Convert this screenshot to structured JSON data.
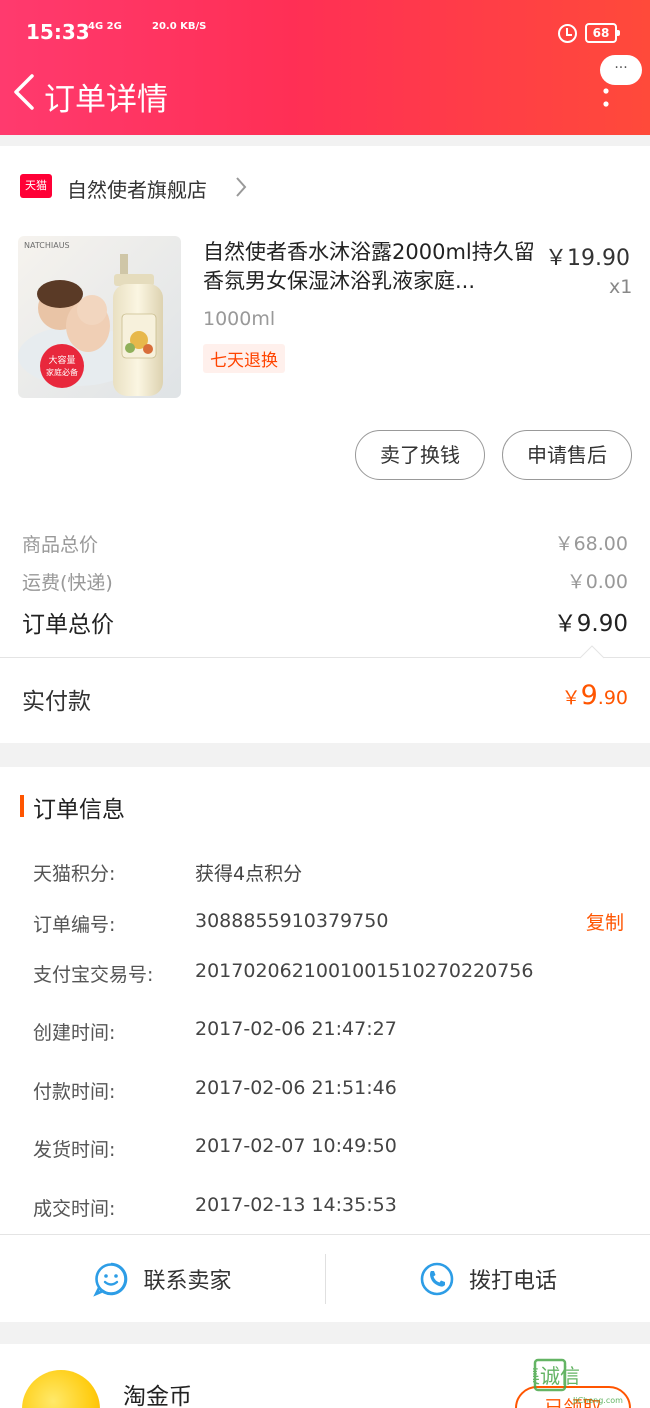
{
  "status_bar": {
    "time": "15:33",
    "signal_text": "4G 2G",
    "speed": "20.0 KB/S",
    "battery": "68"
  },
  "header": {
    "title": "订单详情",
    "more_label": "···"
  },
  "shop": {
    "badge": "天猫",
    "name": "自然使者旗舰店"
  },
  "product": {
    "title": "自然使者香水沐浴露2000ml持久留香氛男女保湿沐浴乳液家庭...",
    "price": "￥19.90",
    "quantity": "x1",
    "spec": "1000ml",
    "return_tag": "七天退换",
    "image_brand": "NATCHIAUS",
    "image_promo_line1": "大容量",
    "image_promo_line2": "家庭必备"
  },
  "buttons": {
    "sell": "卖了换钱",
    "after_sale": "申请售后"
  },
  "summary": {
    "goods_total_label": "商品总价",
    "goods_total_value": "￥68.00",
    "shipping_label": "运费(快递)",
    "shipping_value": "￥0.00",
    "order_total_label": "订单总价",
    "order_total_value": "￥9.90",
    "paid_label": "实付款",
    "paid_currency": "￥",
    "paid_integer": "9",
    "paid_decimal": ".90"
  },
  "order_info": {
    "section_title": "订单信息",
    "copy_label": "复制",
    "rows": [
      {
        "label": "天猫积分:",
        "value": "获得4点积分"
      },
      {
        "label": "订单编号:",
        "value": "3088855910379750"
      },
      {
        "label": "支付宝交易号:",
        "value": "2017020621001001510270220756"
      },
      {
        "label": "创建时间:",
        "value": "2017-02-06 21:47:27"
      },
      {
        "label": "付款时间:",
        "value": "2017-02-06 21:51:46"
      },
      {
        "label": "发货时间:",
        "value": "2017-02-07 10:49:50"
      },
      {
        "label": "成交时间:",
        "value": "2017-02-13 14:35:53"
      }
    ]
  },
  "actions": {
    "contact_seller": "联系卖家",
    "call_phone": "拨打电话"
  },
  "coins": {
    "label": "淘金币",
    "button": "已领取"
  },
  "watermark": {
    "text": "集诚信",
    "sub": "JiCheng.com"
  },
  "colors": {
    "accent": "#ff5500",
    "header_start": "#ff3a6e",
    "header_end": "#ff4a3a",
    "tmall_red": "#ff0036",
    "icon_blue": "#2d9de6"
  }
}
